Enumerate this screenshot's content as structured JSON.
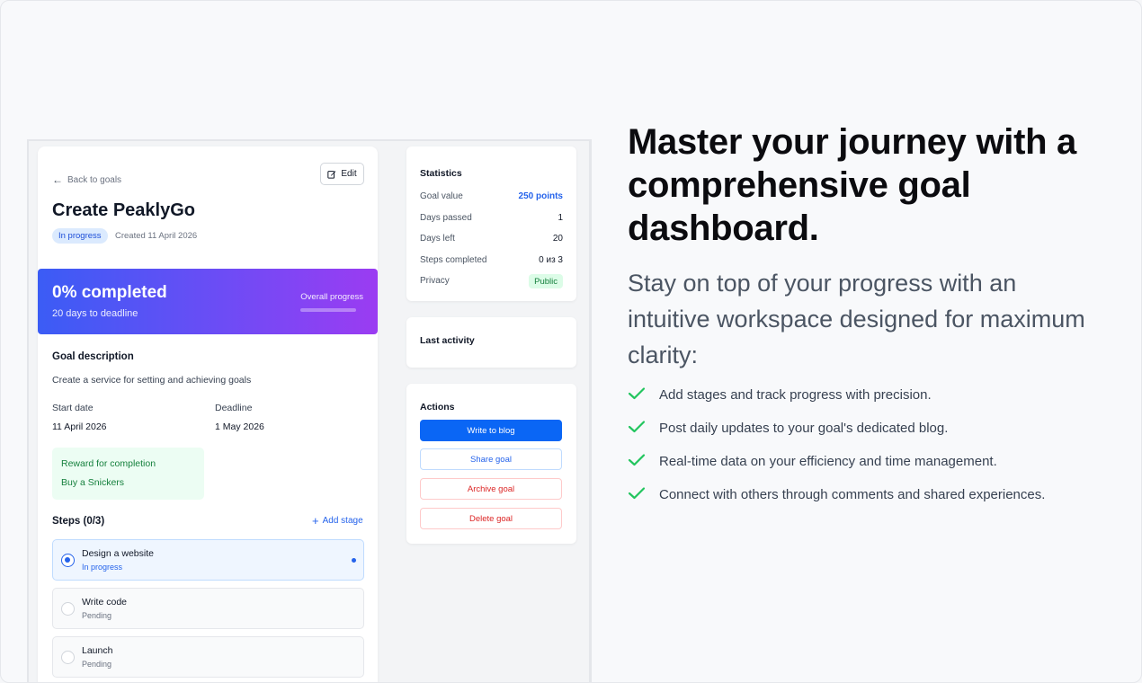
{
  "app": {
    "back_label": "Back to goals",
    "edit_label": "Edit",
    "goal_title": "Create PeaklyGo",
    "status": "In progress",
    "created": "Created 11 April 2026",
    "progress": {
      "percent_label": "0% completed",
      "deadline_label": "20 days to deadline",
      "overall_label": "Overall progress",
      "value": 0
    },
    "description": {
      "heading": "Goal description",
      "text": "Create a service for setting and achieving goals"
    },
    "dates": {
      "start_label": "Start date",
      "start_value": "11 April 2026",
      "deadline_label": "Deadline",
      "deadline_value": "1 May 2026"
    },
    "reward": {
      "title": "Reward for completion",
      "value": "Buy a Snickers"
    },
    "steps": {
      "heading": "Steps (0/3)",
      "add_label": "Add stage",
      "items": [
        {
          "name": "Design a website",
          "status": "In progress"
        },
        {
          "name": "Write code",
          "status": "Pending"
        },
        {
          "name": "Launch",
          "status": "Pending"
        }
      ]
    },
    "statistics": {
      "heading": "Statistics",
      "goal_value_label": "Goal value",
      "goal_value": "250 points",
      "days_passed_label": "Days passed",
      "days_passed": "1",
      "days_left_label": "Days left",
      "days_left": "20",
      "steps_completed_label": "Steps completed",
      "steps_completed": "0 из 3",
      "privacy_label": "Privacy",
      "privacy": "Public"
    },
    "last_activity": {
      "heading": "Last activity"
    },
    "actions": {
      "heading": "Actions",
      "write_blog": "Write to blog",
      "share": "Share goal",
      "archive": "Archive goal",
      "delete": "Delete goal"
    }
  },
  "marketing": {
    "headline": "Master your journey with a comprehensive goal dashboard.",
    "subhead": "Stay on top of your progress with an intuitive workspace designed for maximum clarity:",
    "features": [
      "Add stages and track progress with precision.",
      "Post daily updates to your goal's dedicated blog.",
      "Real-time data on your efficiency and time management.",
      "Connect with others through comments and shared experiences."
    ]
  },
  "colors": {
    "accent": "#2563eb",
    "gradient_start": "#3b5cf5",
    "gradient_end": "#9b3cf2",
    "check": "#22c55e",
    "danger": "#dc2626"
  }
}
